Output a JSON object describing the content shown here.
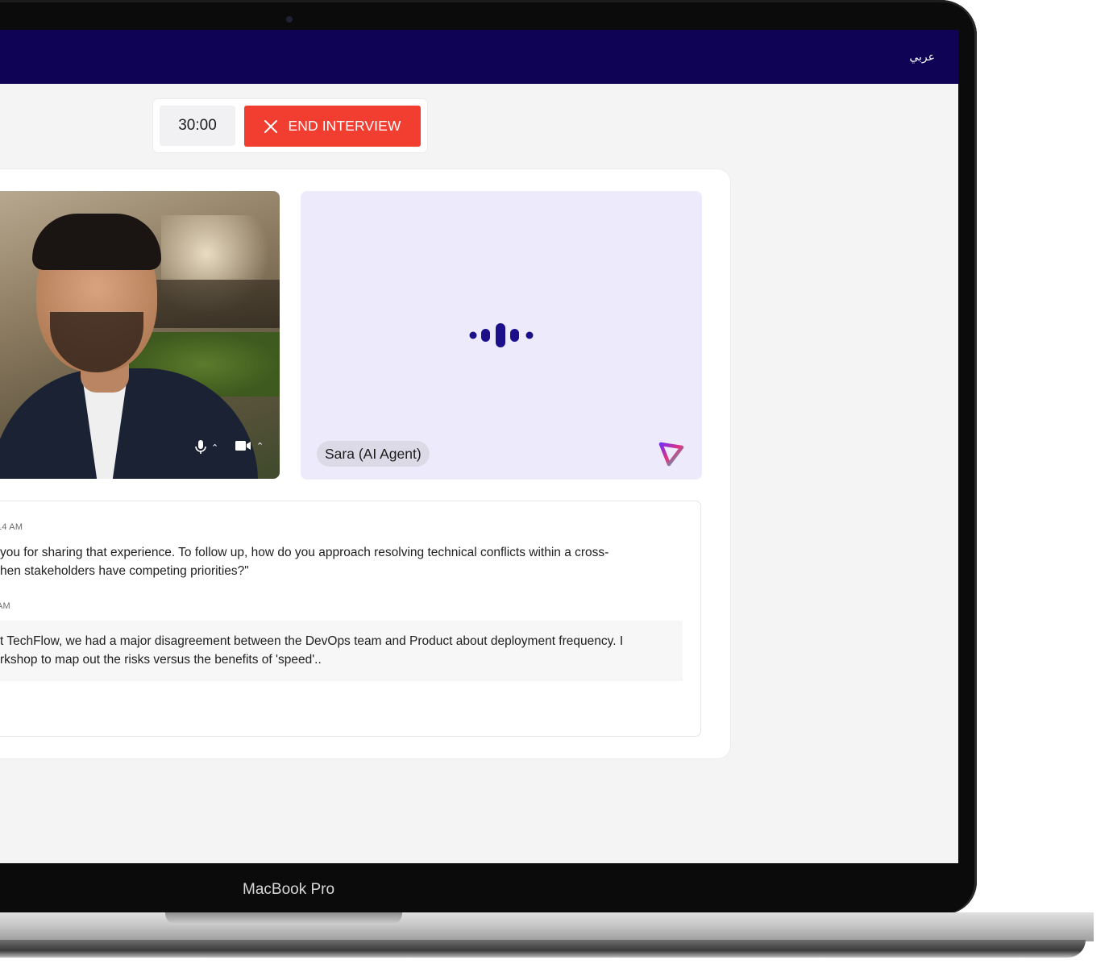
{
  "device": {
    "brand_label": "MacBook Pro"
  },
  "header": {
    "language_toggle": "عربي"
  },
  "controls": {
    "timer": "30:00",
    "end_button_label": "END INTERVIEW"
  },
  "agent": {
    "name": "Sara (AI Agent)"
  },
  "transcript": {
    "messages": [
      {
        "time": "14 AM",
        "line1": "you for sharing that experience. To follow up, how do you approach resolving technical conflicts within a cross-",
        "line2": "hen stakeholders have competing priorities?\""
      },
      {
        "time": "AM",
        "line1": "t TechFlow, we had a major disagreement between the DevOps team and Product about deployment frequency. I",
        "line2": "rkshop to map out the risks versus the benefits of 'speed'.."
      }
    ]
  },
  "colors": {
    "header_bg": "#0f0356",
    "end_button": "#f23d31",
    "agent_tile": "#edeafb",
    "waveform": "#1c0f8a"
  }
}
